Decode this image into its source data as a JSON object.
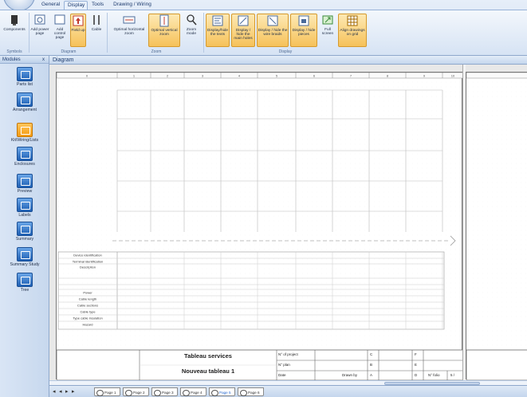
{
  "tabs": [
    "General",
    "Display",
    "Tools",
    "Drawing / Wiring"
  ],
  "active_tab": "Display",
  "ribbon": {
    "groups": [
      {
        "label": "Symbols"
      },
      {
        "label": "Diagram"
      },
      {
        "label": "Zoom"
      },
      {
        "label": "Display"
      }
    ],
    "buttons": [
      "Components",
      "Add power page",
      "Add control page",
      "Field up",
      "Cable",
      "Optimal horizontal zoom",
      "Optimal vertical zoom",
      "Zoom mode",
      "Display/hide the texts",
      "Display / hide the main holes",
      "Display / hide the wire braids",
      "Display / hide pieces",
      "Full screen",
      "Align drawings on grid"
    ]
  },
  "modules": {
    "title": "Modules",
    "close": "x",
    "items": [
      "Parts list",
      "Arrangement",
      "Kit/Wiring/Lists",
      "Enclosures",
      "Preview",
      "Labels",
      "Summary",
      "Summary Study",
      "Tree"
    ]
  },
  "diagram": {
    "title": "Diagram",
    "columns": [
      "0",
      "1",
      "2",
      "3",
      "4",
      "5",
      "6",
      "7",
      "8",
      "9",
      "10"
    ],
    "row_labels": [
      "Device identification",
      "Terminal identification",
      "Description",
      "",
      "",
      "Power",
      "Cable length",
      "Cable sections",
      "Cable type",
      "Type cable insulation",
      "Hazard"
    ],
    "title_block": {
      "name": "Tableau services",
      "subtitle": "Nouveau tableau 1",
      "project_label": "N° of project",
      "plan_label": "N° plan",
      "date_label": "Date",
      "drawn_label": "Drawn by",
      "folio_label": "N° folio",
      "folio_value": "5 /",
      "letters": [
        "C",
        "B",
        "A"
      ],
      "right_letters": [
        "F",
        "E",
        "D"
      ]
    }
  },
  "pages": [
    "Page 1",
    "Page 2",
    "Page 3",
    "Page 4",
    "Page 5",
    "Page 6"
  ],
  "active_page": "Page 5",
  "colors": {
    "accent": "#f6c25a",
    "ribbon": "#d6e3f4",
    "module_icon": "#1e5fb3"
  }
}
